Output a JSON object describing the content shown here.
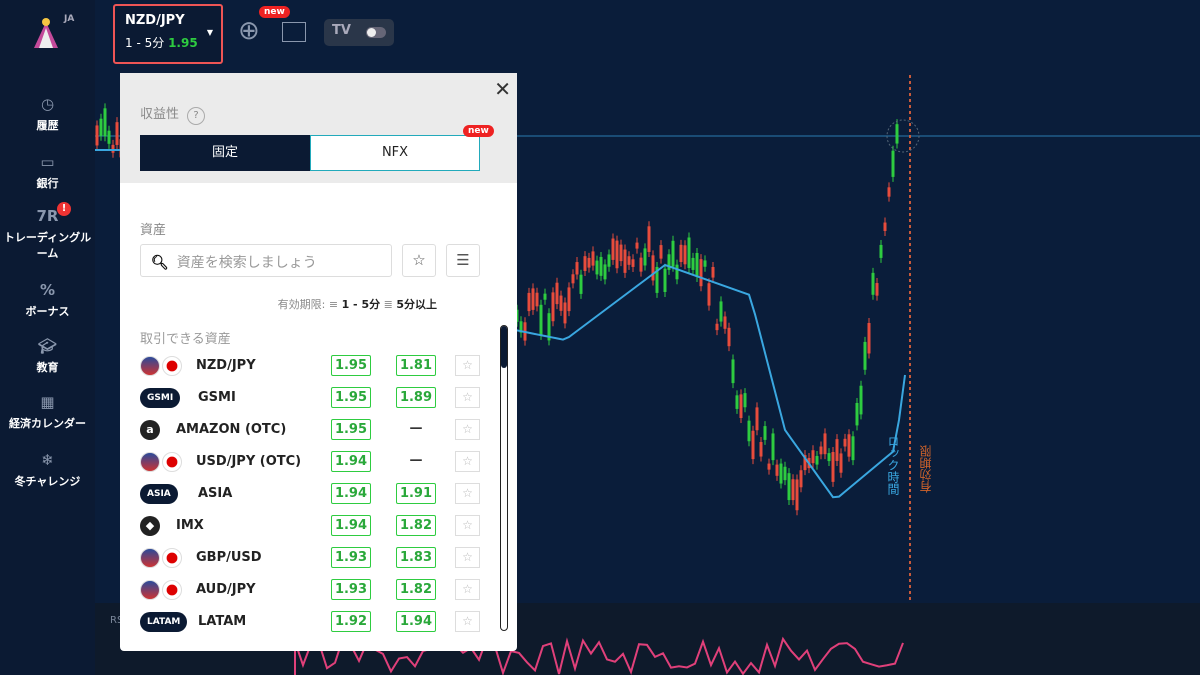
{
  "header": {
    "language": "JA",
    "asset": {
      "name": "NZD/JPY",
      "expiry": "1 - 5分",
      "payout": "1.95"
    },
    "new_badge": "new",
    "tv_label": "TV"
  },
  "sidebar": {
    "items": [
      {
        "label": "履歴",
        "icon": "history-icon"
      },
      {
        "label": "銀行",
        "icon": "wallet-icon"
      },
      {
        "label": "トレーディングルーム",
        "icon": "trading-room-icon",
        "badge": "!"
      },
      {
        "label": "ボーナス",
        "icon": "percent-icon"
      },
      {
        "label": "教育",
        "icon": "graduation-cap-icon"
      },
      {
        "label": "経済カレンダー",
        "icon": "calendar-icon"
      },
      {
        "label": "冬チャレンジ",
        "icon": "snowflake-icon"
      }
    ]
  },
  "panel": {
    "profitability_label": "収益性",
    "help": "?",
    "tabs": [
      {
        "label": "固定",
        "active": true
      },
      {
        "label": "NFX",
        "badge": "new"
      }
    ],
    "assets_label": "資産",
    "search_placeholder": "資産を検索しましょう",
    "expiry_label": "有効期限:",
    "expiry_short": "1 - 5分",
    "expiry_long": "5分以上",
    "available_label": "取引できる資産",
    "rows": [
      {
        "name": "NZD/JPY",
        "icon": "flags",
        "p1": "1.95",
        "p2": "1.81"
      },
      {
        "name": "GSMI",
        "icon": "pill",
        "tag": "GSMI",
        "p1": "1.95",
        "p2": "1.89"
      },
      {
        "name": "AMAZON (OTC)",
        "icon": "circle",
        "tag": "a",
        "p1": "1.95",
        "p2": "—"
      },
      {
        "name": "USD/JPY (OTC)",
        "icon": "flags",
        "p1": "1.94",
        "p2": "—"
      },
      {
        "name": "ASIA",
        "icon": "pill",
        "tag": "ASIA",
        "p1": "1.94",
        "p2": "1.91"
      },
      {
        "name": "IMX",
        "icon": "circle",
        "tag": "◆",
        "p1": "1.94",
        "p2": "1.82"
      },
      {
        "name": "GBP/USD",
        "icon": "flags",
        "p1": "1.93",
        "p2": "1.83"
      },
      {
        "name": "AUD/JPY",
        "icon": "flags",
        "p1": "1.93",
        "p2": "1.82"
      },
      {
        "name": "LATAM",
        "icon": "pill",
        "tag": "LATAM",
        "p1": "1.92",
        "p2": "1.94"
      }
    ]
  },
  "chart": {
    "lock_label": "ロック時間",
    "expiry_label": "有効期限",
    "lower_label": "RSI"
  },
  "colors": {
    "up": "#2ecc40",
    "down": "#e74c3c",
    "ma": "#3aa7e0",
    "rsi": "#e0407a"
  }
}
